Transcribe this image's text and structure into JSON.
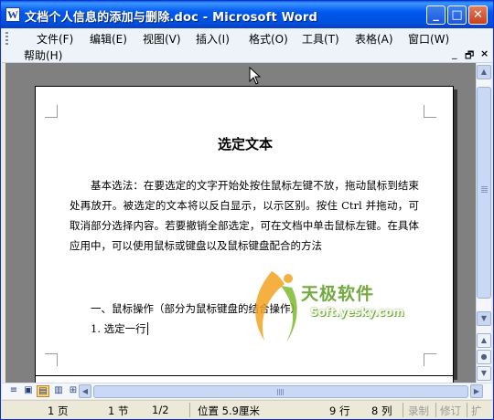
{
  "window": {
    "title": "文档个人信息的添加与删除.doc - Microsoft Word",
    "app_icon": "W",
    "controls": {
      "minimize": "_",
      "maximize": "□",
      "close": "✕"
    }
  },
  "menubar": {
    "items": [
      "文件(F)",
      "编辑(E)",
      "视图(V)",
      "插入(I)",
      "格式(O)",
      "工具(T)",
      "表格(A)",
      "窗口(W)"
    ],
    "row2_item": "帮助(H)",
    "doc_controls": {
      "minimize": "_",
      "restore": "🗗",
      "close": "×"
    }
  },
  "document": {
    "title": "选定文本",
    "paragraph": "基本选法：在要选定的文字开始处按住鼠标左键不放，拖动鼠标到结束处再放开。被选定的文本将以反白显示，以示区别。按住 Ctrl 并拖动，可取消部分选择内容。若要撤销全部选定，可在文档中单击鼠标左键。在具体应用中，可以使用鼠标或键盘以及鼠标键盘配合的方法",
    "line_1": "一、鼠标操作（部分为鼠标键盘的结合操作）",
    "line_2": "1. 选定一行"
  },
  "watermark": {
    "text": "天极软件",
    "url": "Soft.yesky.com"
  },
  "view_buttons": [
    "≡",
    "▣",
    "▤",
    "▥",
    "⊞"
  ],
  "statusbar": {
    "page": "1 页",
    "section": "1 节",
    "page_of": "1/2",
    "position": "位置 5.9厘米",
    "line": "9 行",
    "column": "8 列",
    "rec": "录制",
    "trk": "修订",
    "ext": "扩"
  }
}
